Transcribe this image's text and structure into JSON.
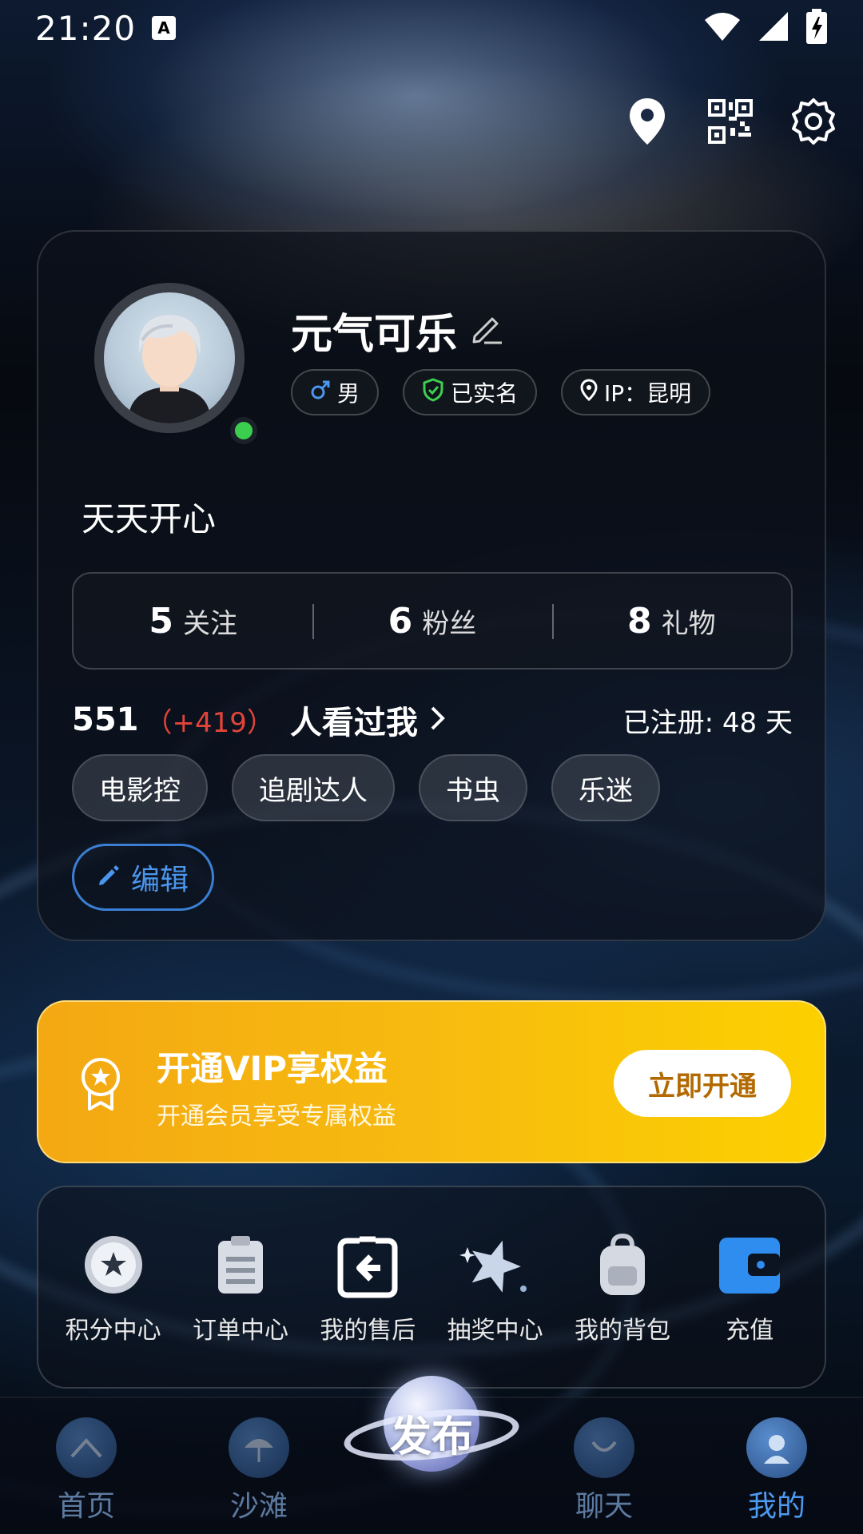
{
  "status_bar": {
    "time": "21:20"
  },
  "profile": {
    "nickname": "元气可乐",
    "gender": "男",
    "verified": "已实名",
    "ip": "IP：昆明",
    "bio": "天天开心",
    "stats": [
      {
        "value": "5",
        "label": "关注"
      },
      {
        "value": "6",
        "label": "粉丝"
      },
      {
        "value": "8",
        "label": "礼物"
      }
    ],
    "visitors": {
      "count": "551",
      "delta": "（+419）",
      "label": "人看过我"
    },
    "registered": "已注册: 48 天",
    "interests": [
      "电影控",
      "追剧达人",
      "书虫",
      "乐迷"
    ],
    "edit_label": "编辑"
  },
  "vip": {
    "title": "开通VIP享权益",
    "subtitle": "开通会员享受专属权益",
    "cta": "立即开通"
  },
  "services": [
    {
      "label": "积分中心",
      "icon": "star-badge-icon"
    },
    {
      "label": "订单中心",
      "icon": "clipboard-icon"
    },
    {
      "label": "我的售后",
      "icon": "return-icon"
    },
    {
      "label": "抽奖中心",
      "icon": "sparkle-star-icon"
    },
    {
      "label": "我的背包",
      "icon": "backpack-icon"
    },
    {
      "label": "充值",
      "icon": "wallet-icon"
    }
  ],
  "bottom_nav": {
    "items": [
      {
        "label": "首页"
      },
      {
        "label": "沙滩"
      },
      {
        "label": "聊天"
      },
      {
        "label": "我的"
      }
    ],
    "publish": "发布"
  },
  "colors": {
    "accent": "#4b96ee",
    "vip_gradient_start": "#f4a812",
    "vip_gradient_end": "#fcd000",
    "delta": "#e2443a",
    "online": "#3ccf4e"
  }
}
